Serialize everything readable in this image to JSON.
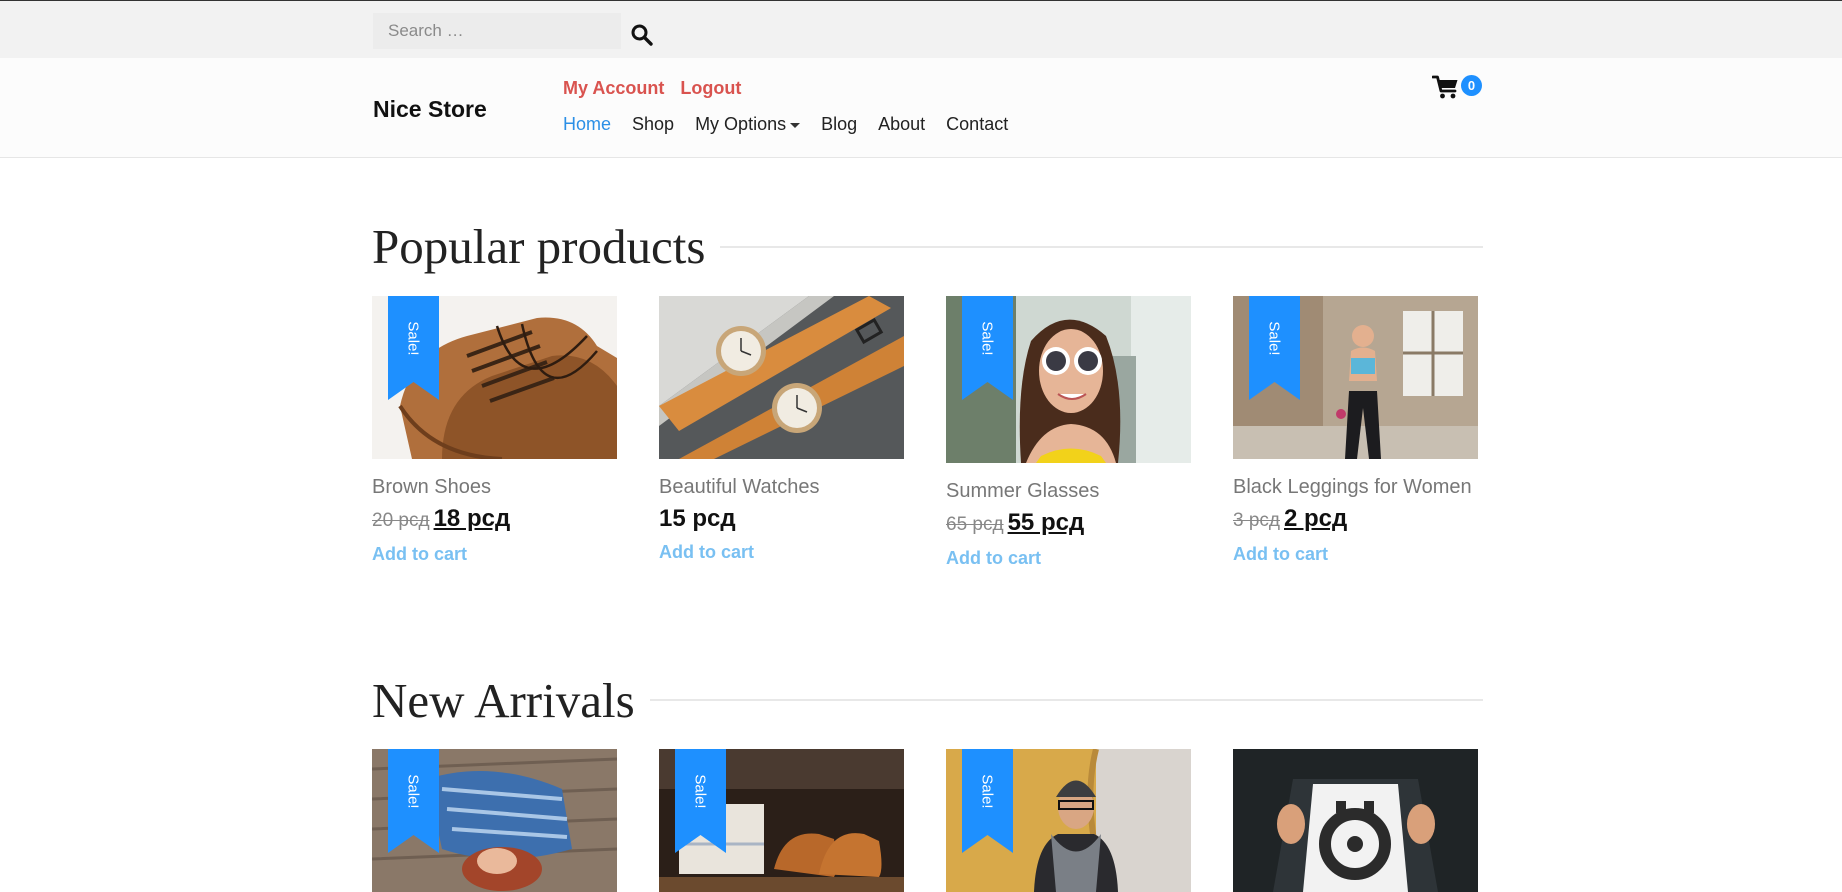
{
  "search": {
    "placeholder": "Search …"
  },
  "header": {
    "brand": "Nice Store",
    "account_links": [
      "My Account",
      "Logout"
    ],
    "nav": [
      "Home",
      "Shop",
      "My Options",
      "Blog",
      "About",
      "Contact"
    ],
    "cart_count": "0"
  },
  "popular": {
    "title": "Popular products",
    "products": [
      {
        "name": "Brown Shoes",
        "old_price": "20 рсд",
        "price": "18 рсд",
        "sale_badge": "Sale!",
        "cta": "Add to cart"
      },
      {
        "name": "Beautiful Watches",
        "old_price": "",
        "price": "15 рсд",
        "sale_badge": "",
        "cta": "Add to cart"
      },
      {
        "name": "Summer Glasses",
        "old_price": "65 рсд",
        "price": "55 рсд",
        "sale_badge": "Sale!",
        "cta": "Add to cart"
      },
      {
        "name": "Black Leggings for Women",
        "old_price": "3 рсд",
        "price": "2 рсд",
        "sale_badge": "Sale!",
        "cta": "Add to cart"
      }
    ]
  },
  "new_arrivals": {
    "title": "New Arrivals",
    "products": [
      {
        "sale_badge": "Sale!"
      },
      {
        "sale_badge": "Sale!"
      },
      {
        "sale_badge": "Sale!"
      },
      {
        "sale_badge": ""
      }
    ]
  },
  "colors": {
    "accent": "#2b8fe6",
    "ribbon": "#1e90ff",
    "account_link": "#d9534f",
    "add_to_cart": "#79c0f2"
  },
  "icons": {
    "search": "search-icon",
    "cart": "shopping-cart-icon",
    "dropdown": "caret-down-icon"
  }
}
